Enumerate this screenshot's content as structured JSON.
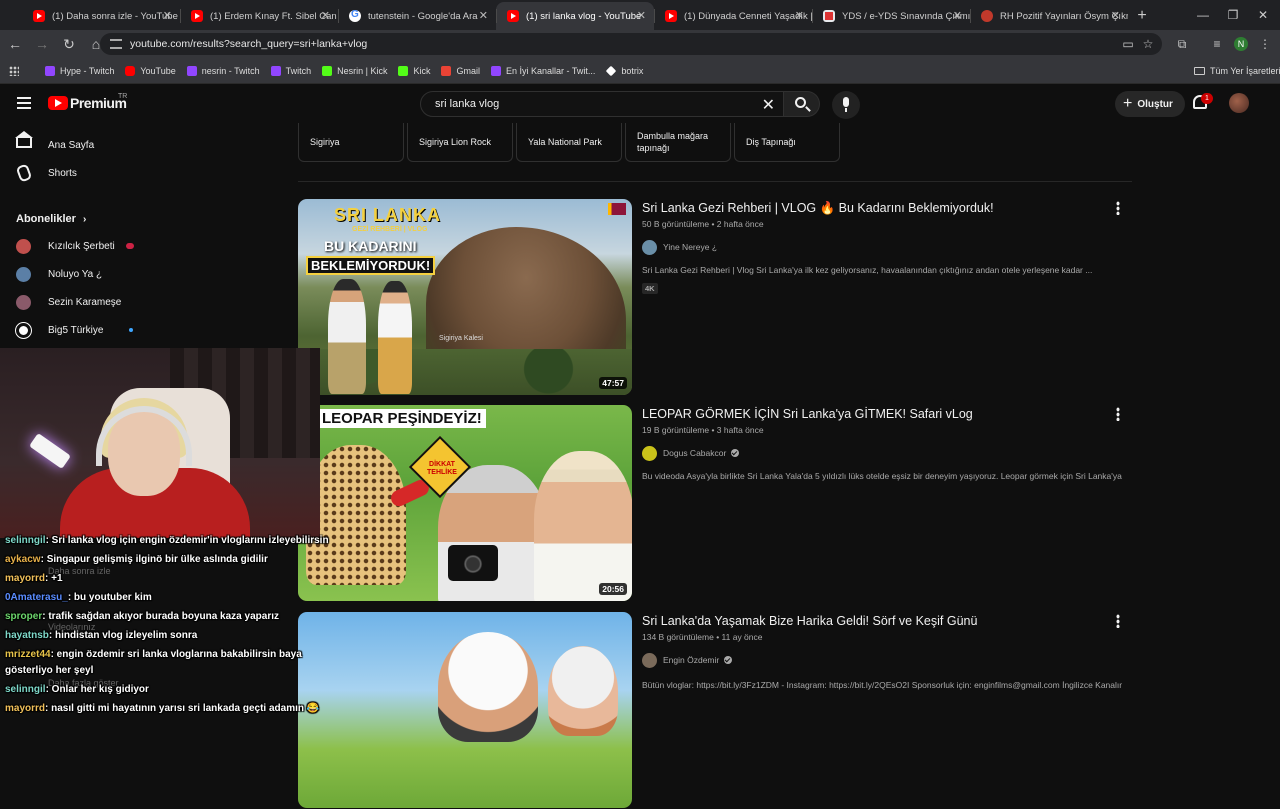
{
  "browser": {
    "tabs": [
      {
        "title": "(1) Daha sonra izle - YouTube",
        "icon": "youtube-icon",
        "active": false
      },
      {
        "title": "(1) Erdem Kınay Ft. Sibel Can - ",
        "icon": "youtube-icon",
        "active": false
      },
      {
        "title": "tutenstein - Google'da Ara",
        "icon": "google-icon",
        "active": false
      },
      {
        "title": "(1) sri lanka vlog - YouTube",
        "icon": "youtube-icon",
        "active": true
      },
      {
        "title": "(1) Dünyada Cenneti Yaşadık | ",
        "icon": "youtube-icon",
        "active": false
      },
      {
        "title": "YDS / e-YDS Sınavında Çıkmış ",
        "icon": "document-icon",
        "active": false
      },
      {
        "title": "RH Pozitif Yayınları Ösym Çıkm",
        "icon": "rh-icon",
        "active": false
      }
    ],
    "new_tab": "+",
    "window_controls": {
      "minimize": "—",
      "maximize": "❐",
      "close": "✕"
    },
    "url": "youtube.com/results?search_query=sri+lanka+vlog",
    "profile_letter": "N",
    "bookmarks": [
      {
        "label": "Hype - Twitch",
        "icon": "twitch-icon"
      },
      {
        "label": "YouTube",
        "icon": "youtube-icon"
      },
      {
        "label": "nesrin - Twitch",
        "icon": "twitch-icon"
      },
      {
        "label": "Twitch",
        "icon": "twitch-icon"
      },
      {
        "label": "Nesrin | Kick",
        "icon": "kick-icon"
      },
      {
        "label": "Kick",
        "icon": "kick-icon"
      },
      {
        "label": "Gmail",
        "icon": "gmail-icon"
      },
      {
        "label": "En İyi Kanallar - Twit...",
        "icon": "twitch-icon"
      },
      {
        "label": "botrix",
        "icon": "botrix-icon"
      }
    ],
    "all_bookmarks": "Tüm Yer İşaretleri"
  },
  "youtube": {
    "logo_text": "Premium",
    "country_code": "TR",
    "search_query": "sri lanka vlog",
    "create_label": "Oluştur",
    "notification_count": "1",
    "sidebar": {
      "main": [
        {
          "label": "Ana Sayfa",
          "icon": "home-icon"
        },
        {
          "label": "Shorts",
          "icon": "shorts-icon"
        }
      ],
      "subscriptions_title": "Abonelikler",
      "channels": [
        {
          "label": "Kızılcık Şerbeti",
          "color": "#c0504d",
          "badge": "live"
        },
        {
          "label": "Noluyo Ya ¿",
          "color": "#5b7fa6",
          "badge": ""
        },
        {
          "label": "Sezin Karameşe",
          "color": "#8a5a6a",
          "badge": ""
        },
        {
          "label": "Big5 Türkiye",
          "color": "#ffffff",
          "badge": "new"
        }
      ],
      "ghost_items": [
        "Daha sonra izle",
        "Videolarınız",
        "Daha fazla göster"
      ]
    },
    "chips": [
      "Sigiriya",
      "Sigiriya Lion Rock",
      "Yala National Park",
      "Dambulla mağara tapınağı",
      "Diş Tapınağı"
    ],
    "results": [
      {
        "title": "Sri Lanka Gezi Rehberi | VLOG 🔥 Bu Kadarını Beklemiyorduk!",
        "meta": "50 B görüntüleme • 2 hafta önce",
        "channel": "Yine Nereye ¿",
        "channel_color": "#6a8fa8",
        "verified": false,
        "description": "Sri Lanka Gezi Rehberi | Vlog Sri Lanka'ya ilk kez geliyorsanız, havaalanından çıktığınız andan otele yerleşene kadar ...",
        "badge": "4K",
        "duration": "47:57",
        "thumb_text": {
          "line1": "SRI LANKA",
          "line2": "GEZİ REHBERİ | VLOG",
          "line3": "BU KADARINI",
          "line4": "BEKLEMİYORDUK!",
          "caption": "Sigiriya Kalesi"
        }
      },
      {
        "title": "LEOPAR GÖRMEK İÇİN Sri Lanka'ya GİTMEK! Safari vLog",
        "meta": "19 B görüntüleme • 3 hafta önce",
        "channel": "Dogus Cabakcor",
        "channel_color": "#c9c21a",
        "verified": true,
        "description": "Bu videoda Asya'yla birlikte Sri Lanka Yala'da 5 yıldızlı lüks otelde eşsiz bir deneyim yaşıyoruz. Leopar görmek için Sri Lanka'ya ...",
        "badge": "",
        "duration": "20:56",
        "thumb_text": {
          "line1": "LEOPAR PEŞİNDEYİZ!",
          "sign": "DİKKAT TEHLİKE"
        }
      },
      {
        "title": "Sri Lanka'da Yaşamak Bize Harika Geldi! Sörf ve Keşif Günü",
        "meta": "134 B görüntüleme • 11 ay önce",
        "channel": "Engin Özdemir",
        "channel_color": "#7a6a5a",
        "verified": true,
        "description": "Bütün vloglar: https://bit.ly/3Fz1ZDM - Instagram: https://bit.ly/2QEsO2I Sponsorluk için: enginfilms@gmail.com İngilizce Kanalımız: ...",
        "badge": "",
        "duration": "",
        "thumb_text": {}
      }
    ]
  },
  "chat": [
    {
      "user": "selinngil",
      "color": "#7ed8c9",
      "msg": ": Sri lanka vlog için engin özdemir'in vloglarını izleyebilirsin"
    },
    {
      "user": "aykacw",
      "color": "#e8b14a",
      "msg": ": Singapur gelişmiş ilginö bir ülke aslında gidilir"
    },
    {
      "user": "mayorrd",
      "color": "#f0c05a",
      "msg": ": +1"
    },
    {
      "user": "0Amaterasu_",
      "color": "#5a8cff",
      "msg": ": bu youtuber kim"
    },
    {
      "user": "sproper",
      "color": "#6cd66c",
      "msg": ": trafik sağdan akıyor burada boyuna kaza yaparız"
    },
    {
      "user": "hayatnsb",
      "color": "#7ed8c9",
      "msg": ": hindistan vlog izleyelim sonra"
    },
    {
      "user": "mrizzet44",
      "color": "#e8c44a",
      "msg": ": engin özdemir sri lanka vloglarına bakabilirsin baya"
    },
    {
      "user": "",
      "color": "#ffffff",
      "msg": "gösterliyo her şeyl"
    },
    {
      "user": "selinngil",
      "color": "#7ed8c9",
      "msg": ": Onlar her kış gidiyor"
    },
    {
      "user": "mayorrd",
      "color": "#f0c05a",
      "msg": ": nasıl gitti mi hayatının yarısı sri lankada geçti adamın 😂"
    }
  ]
}
